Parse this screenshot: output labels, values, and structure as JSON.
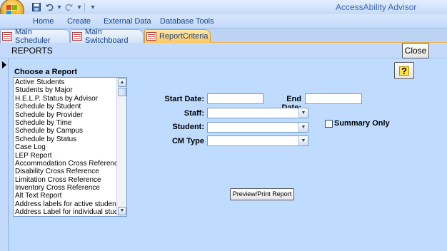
{
  "window": {
    "title": "AccessAbility Advisor"
  },
  "quick_access": {
    "save_icon": "save-icon",
    "undo_icon": "undo-icon",
    "redo_icon": "redo-icon",
    "customize_icon": "customize-qat-icon"
  },
  "ribbon": {
    "tabs": [
      "Home",
      "Create",
      "External Data",
      "Database Tools"
    ]
  },
  "doc_tabs": [
    {
      "label": "Main Scheduler",
      "active": false
    },
    {
      "label": "Main Switchboard",
      "active": false
    },
    {
      "label": "ReportCriteria",
      "active": true
    }
  ],
  "form": {
    "header_title": "REPORTS",
    "close_label": "Close",
    "help_label": "?",
    "choose_label": "Choose a Report",
    "reports": [
      "Active Students",
      "Students by Major",
      "H.E.L.P. Status by Advisor",
      "Schedule by Student",
      "Schedule by Provider",
      "Schedule by Time",
      "Schedule by Campus",
      "Schedule by Status",
      "Case Log",
      "LEP Report",
      "Accommodation Cross Reference",
      "Disability Cross Reference",
      "Limitation Cross Reference",
      "Inventory Cross Reference",
      "Alt Text Report",
      "Address labels for active students",
      "Address Label for individual student"
    ],
    "start_date_label": "Start Date:",
    "start_date_value": "",
    "end_date_label": "End Date:",
    "end_date_value": "",
    "staff_label": "Staff:",
    "staff_value": "",
    "student_label": "Student:",
    "student_value": "",
    "cm_type_label": "CM Type",
    "cm_type_value": "",
    "summary_only_label": "Summary Only",
    "summary_only_checked": false,
    "preview_label": "Preview/Print Report"
  },
  "colors": {
    "form_background": "#bfdbff",
    "active_tab": "#ffc85a",
    "text": "#15428b"
  }
}
